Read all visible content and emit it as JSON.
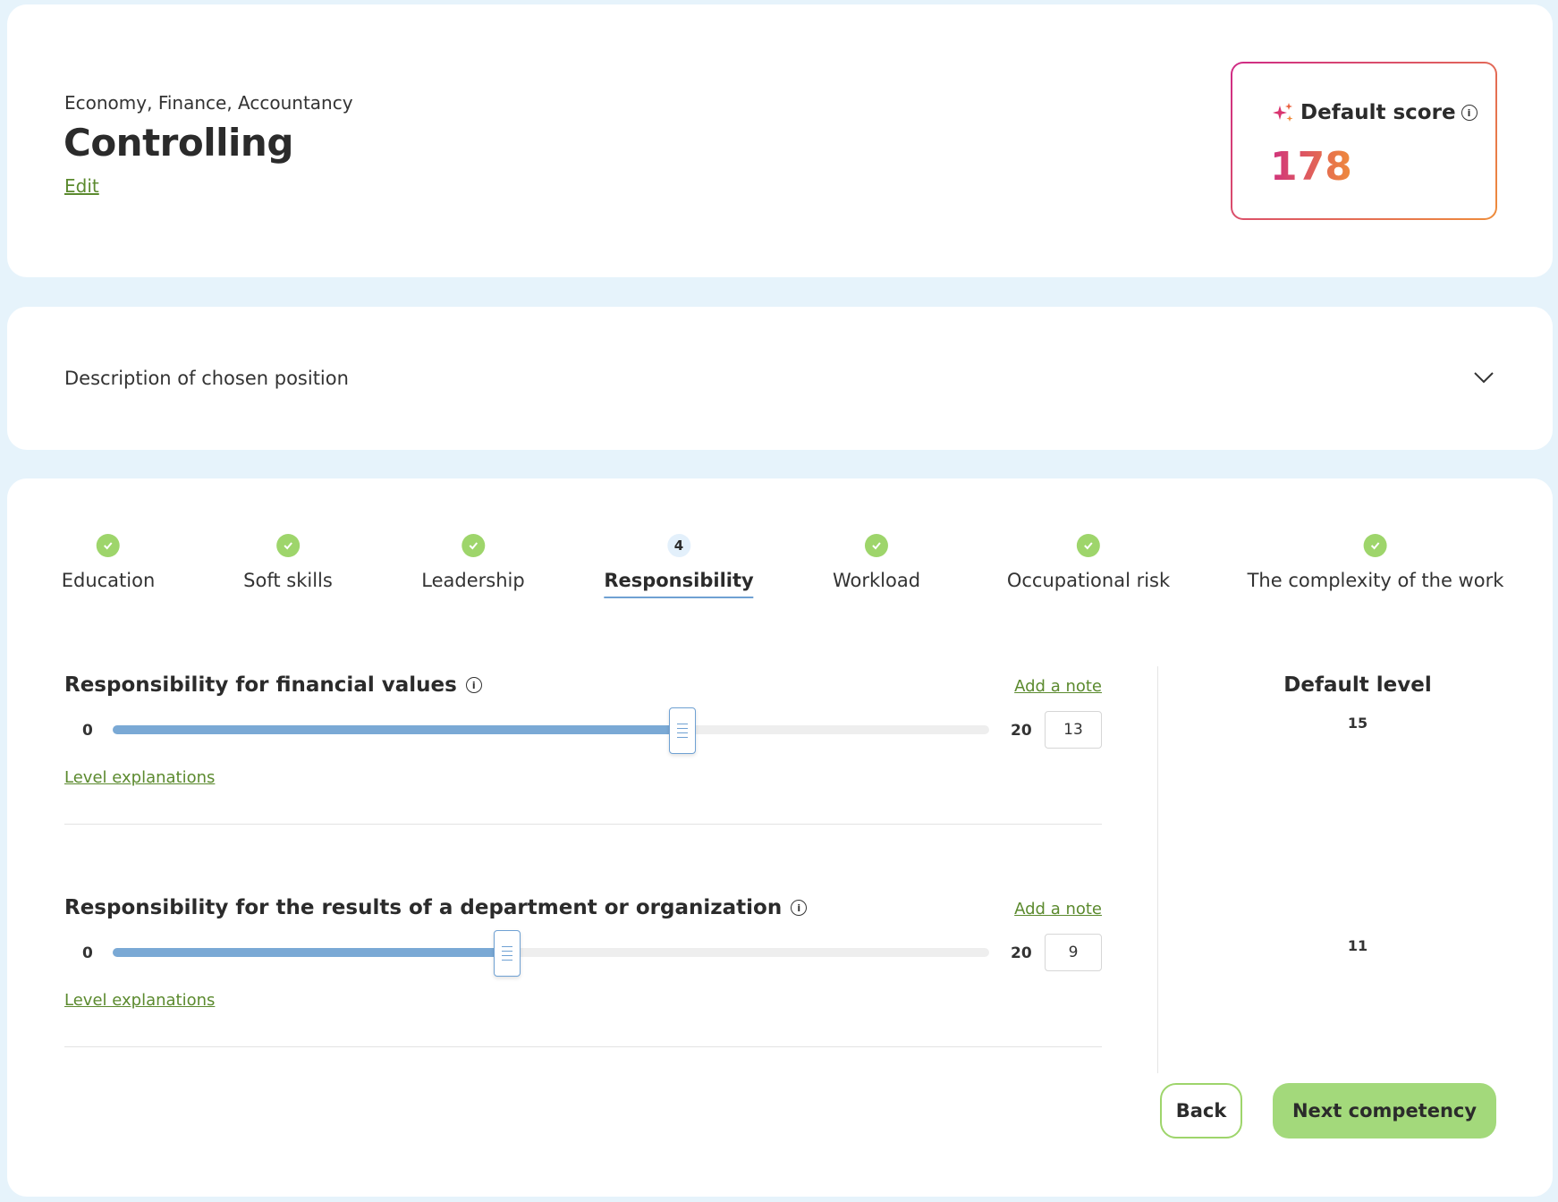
{
  "header": {
    "category": "Economy, Finance, Accountancy",
    "title": "Controlling",
    "edit_label": "Edit"
  },
  "score": {
    "label": "Default score",
    "value": "178",
    "gradient_start": "#cf2a86",
    "gradient_end": "#ee8d3b"
  },
  "description": {
    "label": "Description of chosen position"
  },
  "steps": [
    {
      "label": "Education",
      "status": "done"
    },
    {
      "label": "Soft skills",
      "status": "done"
    },
    {
      "label": "Leadership",
      "status": "done"
    },
    {
      "label": "Responsibility",
      "status": "active",
      "number": "4"
    },
    {
      "label": "Workload",
      "status": "done"
    },
    {
      "label": "Occupational risk",
      "status": "done"
    },
    {
      "label": "The complexity of the work",
      "status": "done"
    }
  ],
  "default_level": {
    "title": "Default level",
    "values": [
      "15",
      "11"
    ]
  },
  "criteria": [
    {
      "title": "Responsibility for financial values",
      "add_note": "Add a note",
      "min": "0",
      "max": "20",
      "value": "13",
      "level_explanations": "Level explanations"
    },
    {
      "title": "Responsibility for the results of a department or organization",
      "add_note": "Add a note",
      "min": "0",
      "max": "20",
      "value": "9",
      "level_explanations": "Level explanations"
    }
  ],
  "buttons": {
    "back": "Back",
    "next": "Next competency"
  },
  "colors": {
    "background": "#e6f3fb",
    "accent_green": "#9ed56b",
    "link_green": "#5b8a2e",
    "slider_blue": "#7aa9d5"
  }
}
